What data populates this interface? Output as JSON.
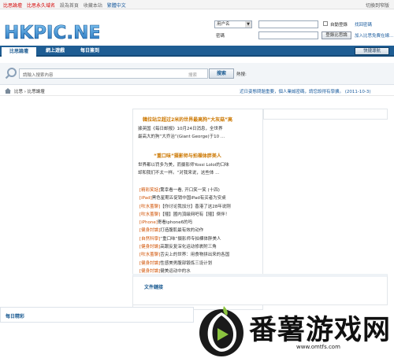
{
  "topbar": {
    "site_link": "比思論壇",
    "domain_link": "比思永久域名",
    "homepage": "設為首頁",
    "bookmark": "收藏本站",
    "lang": "繁體中文",
    "switch_style": "切換到窄版"
  },
  "header": {
    "logo_text": "HKPIC.NET",
    "username_select": "用户名",
    "password_label": "密碼",
    "auto_login": "自動登錄",
    "login_button": "登錄比思論",
    "forgot_password": "找回密碼",
    "register_link": "加入比思免費在線..."
  },
  "nav": {
    "tabs": [
      "比思論壇",
      "網上遊戲",
      "每日簽到"
    ],
    "quick_nav": "快捷導航"
  },
  "search": {
    "placeholder": "請輸入搜索內容",
    "type": "搜索",
    "button": "搜索",
    "hot_label": "熱搜:"
  },
  "breadcrumb": {
    "path": "比思 › 比思論壇",
    "notice": "近日姿態問題重要，個人業誠密碼，請您設得有學擴。 (2011-10-3)"
  },
  "article": {
    "headline1": "韓拉站立超过2米的世界最高狗“大灰菇”高",
    "para1_line1": "據英国《每日邮报》10月24日消息，全世界",
    "para1_line2": "最高大的狗“大乔治”(Giant George)于10 ...",
    "headline2": "“重口味”摄影师与拍裸体胖美人",
    "para2_line1": "世界都以罚多为美，而摄影师Yossi Loloi的口味",
    "para2_line2": "却和我们不太一样。“对我来说，这些体 ...",
    "items": [
      {
        "tag": "[精彩笑話]",
        "text": "驚幸看一看, 开口笑一笑 (十四)"
      },
      {
        "tag": "[iPad]",
        "text": "黑色星期五促销中国iPad有买者为安桌"
      },
      {
        "tag": "[吹水蓋聊]",
        "text": "【你讨论我加分】香港了这28年说刚"
      },
      {
        "tag": "[吹水蓋聊]",
        "text": "【殭】國内頂級网吧有【殭】倒伴！"
      },
      {
        "tag": "[iPhone]",
        "text": "寄看iphone6的吗"
      },
      {
        "tag": "[健身討論]",
        "text": "打造腹肌最有效的动作"
      },
      {
        "tag": "[自然科學]",
        "text": "“重口味”摄影师专拍裸体胖美人"
      },
      {
        "tag": "[健身討論]",
        "text": "高跟反复深化运动修裹附三角"
      },
      {
        "tag": "[吹水蓋聊]",
        "text": "舌尖上的世界：用食物拼出来的各国"
      },
      {
        "tag": "[健身討論]",
        "text": "性感美男腹部锻炼三设计划"
      },
      {
        "tag": "[健身討論]",
        "text": "健美运动中的水"
      }
    ],
    "attachments_title": "文件鏈接"
  },
  "daily": {
    "title": "每日精彩"
  },
  "watermark": {
    "brand": "番薯游戏网",
    "url": "www.omtfs.com"
  },
  "colors": {
    "nav_blue": "#1e5d93",
    "headline_orange": "#cc7700",
    "tag_orange": "#d05000",
    "topbar_red": "#d40000"
  }
}
